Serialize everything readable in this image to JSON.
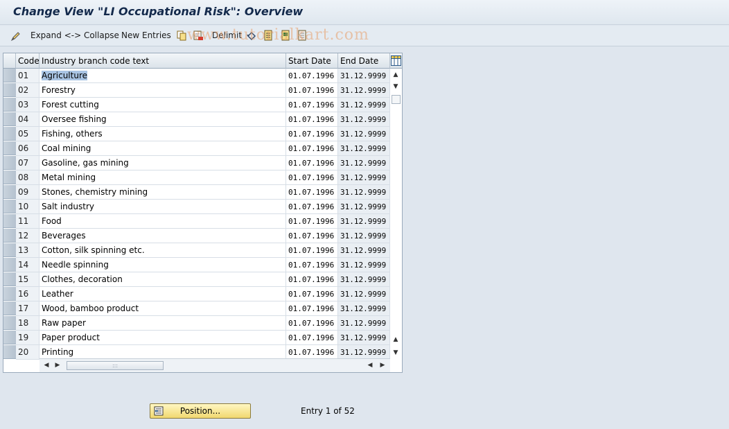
{
  "window": {
    "title": "Change View \"LI Occupational Risk\": Overview"
  },
  "toolbar": {
    "expand_collapse_label": "Expand <-> Collapse",
    "new_entries_label": "New Entries",
    "delimit_label": "Delimit",
    "icons": [
      "change-display-icon",
      "copy-icon",
      "delete-icon",
      "undo-change-icon",
      "select-all-icon",
      "select-block-icon",
      "deselect-all-icon"
    ]
  },
  "watermark": "www.tutorialkart.com",
  "table": {
    "columns": [
      "Code",
      "Industry branch code text",
      "Start Date",
      "End Date"
    ],
    "column_settings_icon": "table-settings-icon",
    "rows": [
      {
        "code": "01",
        "text": "Agriculture",
        "start": "01.07.1996",
        "end": "31.12.9999"
      },
      {
        "code": "02",
        "text": "Forestry",
        "start": "01.07.1996",
        "end": "31.12.9999"
      },
      {
        "code": "03",
        "text": "Forest cutting",
        "start": "01.07.1996",
        "end": "31.12.9999"
      },
      {
        "code": "04",
        "text": "Oversee fishing",
        "start": "01.07.1996",
        "end": "31.12.9999"
      },
      {
        "code": "05",
        "text": "Fishing, others",
        "start": "01.07.1996",
        "end": "31.12.9999"
      },
      {
        "code": "06",
        "text": "Coal mining",
        "start": "01.07.1996",
        "end": "31.12.9999"
      },
      {
        "code": "07",
        "text": "Gasoline, gas mining",
        "start": "01.07.1996",
        "end": "31.12.9999"
      },
      {
        "code": "08",
        "text": "Metal mining",
        "start": "01.07.1996",
        "end": "31.12.9999"
      },
      {
        "code": "09",
        "text": "Stones, chemistry mining",
        "start": "01.07.1996",
        "end": "31.12.9999"
      },
      {
        "code": "10",
        "text": "Salt industry",
        "start": "01.07.1996",
        "end": "31.12.9999"
      },
      {
        "code": "11",
        "text": "Food",
        "start": "01.07.1996",
        "end": "31.12.9999"
      },
      {
        "code": "12",
        "text": "Beverages",
        "start": "01.07.1996",
        "end": "31.12.9999"
      },
      {
        "code": "13",
        "text": "Cotton, silk spinning etc.",
        "start": "01.07.1996",
        "end": "31.12.9999"
      },
      {
        "code": "14",
        "text": "Needle spinning",
        "start": "01.07.1996",
        "end": "31.12.9999"
      },
      {
        "code": "15",
        "text": "Clothes, decoration",
        "start": "01.07.1996",
        "end": "31.12.9999"
      },
      {
        "code": "16",
        "text": "Leather",
        "start": "01.07.1996",
        "end": "31.12.9999"
      },
      {
        "code": "17",
        "text": "Wood, bamboo product",
        "start": "01.07.1996",
        "end": "31.12.9999"
      },
      {
        "code": "18",
        "text": "Raw paper",
        "start": "01.07.1996",
        "end": "31.12.9999"
      },
      {
        "code": "19",
        "text": "Paper product",
        "start": "01.07.1996",
        "end": "31.12.9999"
      },
      {
        "code": "20",
        "text": "Printing",
        "start": "01.07.1996",
        "end": "31.12.9999"
      }
    ]
  },
  "footer": {
    "position_button_label": "Position...",
    "entry_info": "Entry 1 of 52"
  },
  "colors": {
    "background": "#dfe6ee",
    "title_text": "#13294b",
    "selected_cell": "#a9c4e3",
    "position_button": "#f1d870"
  }
}
